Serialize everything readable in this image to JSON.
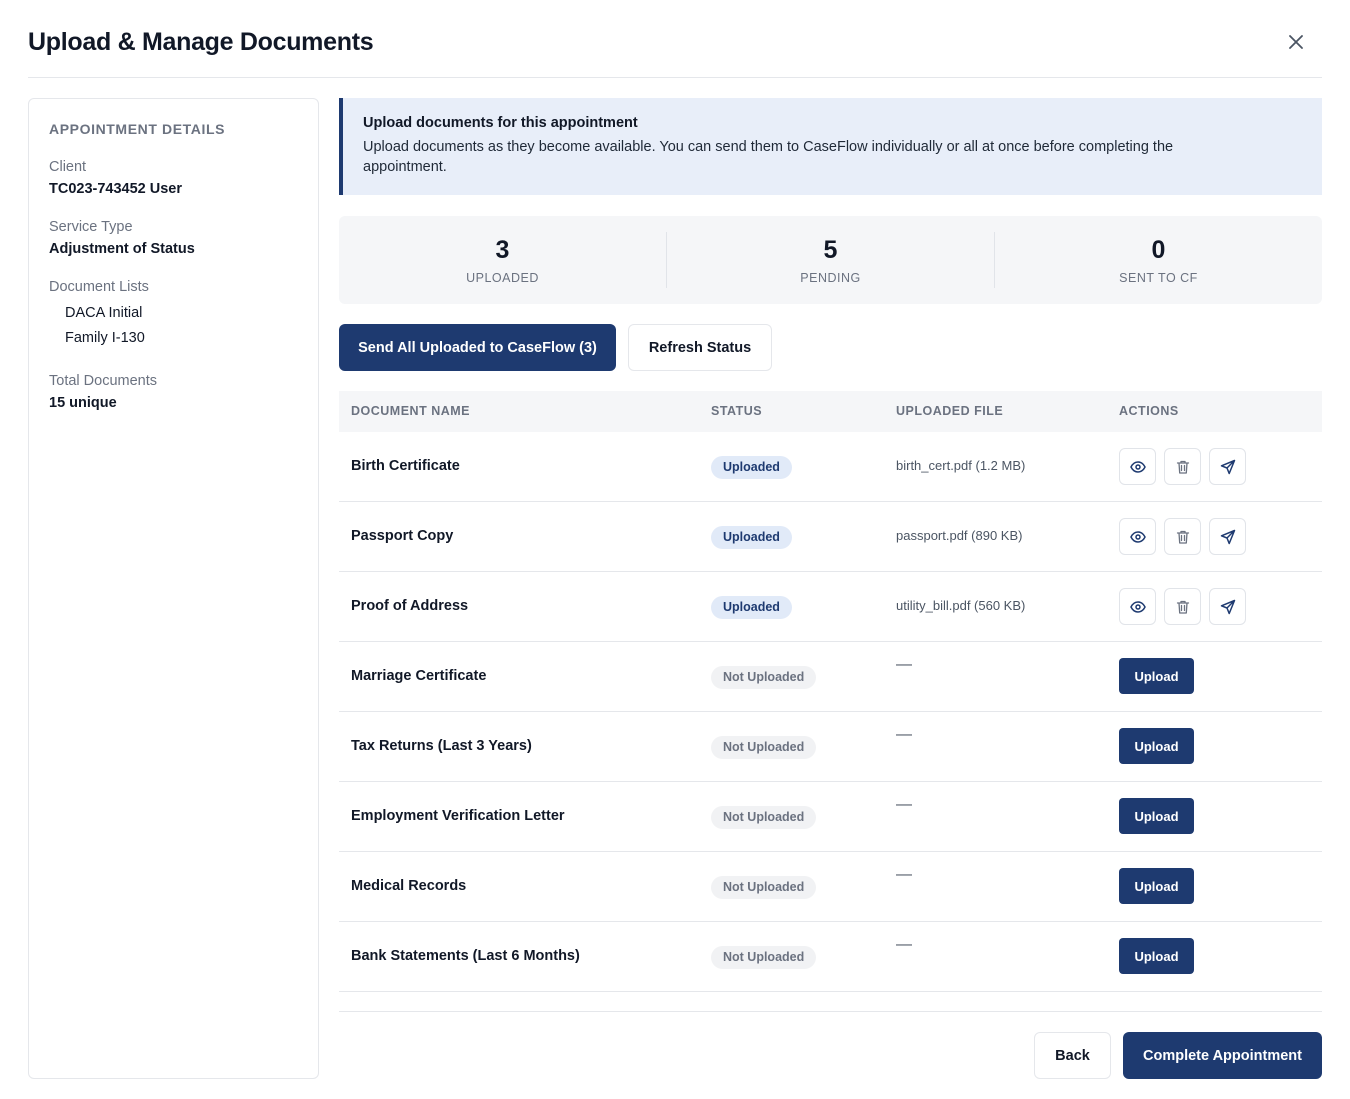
{
  "header": {
    "title": "Upload & Manage Documents"
  },
  "sidebar": {
    "heading": "APPOINTMENT DETAILS",
    "client_label": "Client",
    "client_value": "TC023-743452 User",
    "service_label": "Service Type",
    "service_value": "Adjustment of Status",
    "lists_label": "Document Lists",
    "lists": [
      "DACA Initial",
      "Family I-130"
    ],
    "total_label": "Total Documents",
    "total_value": "15 unique"
  },
  "banner": {
    "title": "Upload documents for this appointment",
    "text": "Upload documents as they become available. You can send them to CaseFlow individually or all at once before completing the appointment."
  },
  "stats": [
    {
      "value": "3",
      "label": "UPLOADED"
    },
    {
      "value": "5",
      "label": "PENDING"
    },
    {
      "value": "0",
      "label": "SENT TO CF"
    }
  ],
  "toolbar": {
    "send_all_label": "Send All Uploaded to CaseFlow (3)",
    "refresh_label": "Refresh Status"
  },
  "table": {
    "headers": [
      "DOCUMENT NAME",
      "STATUS",
      "UPLOADED FILE",
      "ACTIONS"
    ],
    "rows": [
      {
        "name": "Birth Certificate",
        "status": "Uploaded",
        "file": "birth_cert.pdf (1.2 MB)"
      },
      {
        "name": "Passport Copy",
        "status": "Uploaded",
        "file": "passport.pdf (890 KB)"
      },
      {
        "name": "Proof of Address",
        "status": "Uploaded",
        "file": "utility_bill.pdf (560 KB)"
      },
      {
        "name": "Marriage Certificate",
        "status": "Not Uploaded",
        "file": "—",
        "action": "Upload"
      },
      {
        "name": "Tax Returns (Last 3 Years)",
        "status": "Not Uploaded",
        "file": "—",
        "action": "Upload"
      },
      {
        "name": "Employment Verification Letter",
        "status": "Not Uploaded",
        "file": "—",
        "action": "Upload"
      },
      {
        "name": "Medical Records",
        "status": "Not Uploaded",
        "file": "—",
        "action": "Upload"
      },
      {
        "name": "Bank Statements (Last 6 Months)",
        "status": "Not Uploaded",
        "file": "—",
        "action": "Upload"
      }
    ]
  },
  "footer": {
    "back_label": "Back",
    "complete_label": "Complete Appointment"
  },
  "colors": {
    "primary": "#1e3a70",
    "banner_bg": "#e8eef9"
  },
  "icons": {
    "close": "close-icon",
    "view": "eye-icon",
    "delete": "trash-icon",
    "send": "send-icon"
  }
}
